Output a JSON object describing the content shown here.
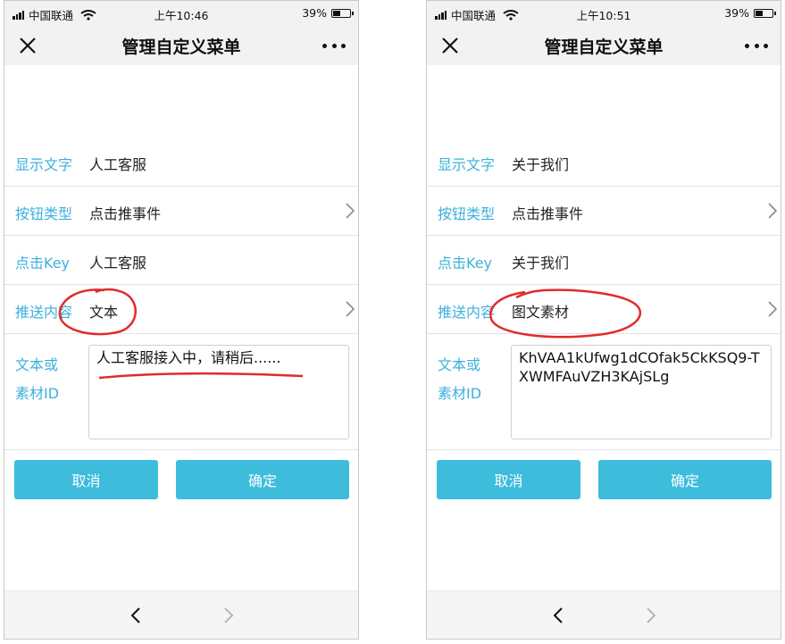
{
  "colors": {
    "accent": "#3db0dc",
    "button": "#3dbcdc",
    "annotation": "#e12a2a"
  },
  "left": {
    "status": {
      "carrier": "中国联通",
      "time": "上午10:46",
      "battery": "39%"
    },
    "title": "管理自定义菜单",
    "rows": [
      {
        "label": "显示文字",
        "value": "人工客服"
      },
      {
        "label": "按钮类型",
        "value": "点击推事件"
      },
      {
        "label": "点击Key",
        "value": "人工客服"
      },
      {
        "label": "推送内容",
        "value": "文本"
      }
    ],
    "textarea": {
      "label_line1": "文本或",
      "label_line2": "素材ID",
      "value": "人工客服接入中，请稍后......"
    },
    "buttons": {
      "cancel": "取消",
      "ok": "确定"
    }
  },
  "right": {
    "status": {
      "carrier": "中国联通",
      "time": "上午10:51",
      "battery": "39%"
    },
    "title": "管理自定义菜单",
    "rows": [
      {
        "label": "显示文字",
        "value": "关于我们"
      },
      {
        "label": "按钮类型",
        "value": "点击推事件"
      },
      {
        "label": "点击Key",
        "value": "关于我们"
      },
      {
        "label": "推送内容",
        "value": "图文素材"
      }
    ],
    "textarea": {
      "label_line1": "文本或",
      "label_line2": "素材ID",
      "value": "KhVAA1kUfwg1dCOfak5CkKSQ9-TXWMFAuVZH3KAjSLg"
    },
    "buttons": {
      "cancel": "取消",
      "ok": "确定"
    }
  }
}
